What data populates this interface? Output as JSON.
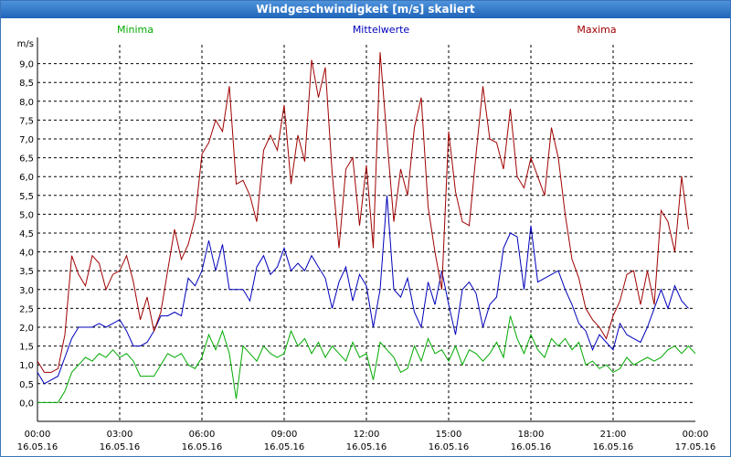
{
  "window": {
    "title": "Windgeschwindigkeit [m/s] skaliert"
  },
  "colors": {
    "minima": "#00aa00",
    "mittelwerte": "#0000bb",
    "maxima": "#a00000",
    "grid": "#000000",
    "titlebar": "#2a6fc2"
  },
  "chart_data": {
    "type": "line",
    "title": "Windgeschwindigkeit [m/s] skaliert",
    "ylabel": "m/s",
    "xlabel": "",
    "ylim": [
      -0.5,
      9.5
    ],
    "yticks": [
      "0,0",
      "0,5",
      "1,0",
      "1,5",
      "2,0",
      "2,5",
      "3,0",
      "3,5",
      "4,0",
      "4,5",
      "5,0",
      "5,5",
      "6,0",
      "6,5",
      "7,0",
      "7,5",
      "8,0",
      "8,5",
      "9,0"
    ],
    "xticks": [
      {
        "time": "00:00",
        "date": "16.05.16"
      },
      {
        "time": "03:00",
        "date": "16.05.16"
      },
      {
        "time": "06:00",
        "date": "16.05.16"
      },
      {
        "time": "09:00",
        "date": "16.05.16"
      },
      {
        "time": "12:00",
        "date": "16.05.16"
      },
      {
        "time": "15:00",
        "date": "16.05.16"
      },
      {
        "time": "18:00",
        "date": "16.05.16"
      },
      {
        "time": "21:00",
        "date": "16.05.16"
      },
      {
        "time": "00:00",
        "date": "17.05.16"
      }
    ],
    "x_unit": "hours",
    "grid": true,
    "legend": "top",
    "series": [
      {
        "name": "Minima",
        "color": "#00aa00",
        "points": [
          [
            0,
            0
          ],
          [
            0.25,
            0
          ],
          [
            0.5,
            0
          ],
          [
            0.75,
            0
          ],
          [
            1,
            0.3
          ],
          [
            1.25,
            0.8
          ],
          [
            1.5,
            1
          ],
          [
            1.75,
            1.2
          ],
          [
            2,
            1.1
          ],
          [
            2.25,
            1.3
          ],
          [
            2.5,
            1.2
          ],
          [
            2.75,
            1.4
          ],
          [
            3,
            1.2
          ],
          [
            3.25,
            1.3
          ],
          [
            3.5,
            1.1
          ],
          [
            3.75,
            0.7
          ],
          [
            4,
            0.7
          ],
          [
            4.25,
            0.7
          ],
          [
            4.5,
            1
          ],
          [
            4.75,
            1.3
          ],
          [
            5,
            1.2
          ],
          [
            5.25,
            1.3
          ],
          [
            5.5,
            1
          ],
          [
            5.75,
            0.9
          ],
          [
            6,
            1.2
          ],
          [
            6.25,
            1.8
          ],
          [
            6.5,
            1.4
          ],
          [
            6.75,
            1.9
          ],
          [
            7,
            1.3
          ],
          [
            7.25,
            0.1
          ],
          [
            7.5,
            1.5
          ],
          [
            7.75,
            1.3
          ],
          [
            8,
            1.1
          ],
          [
            8.25,
            1.5
          ],
          [
            8.5,
            1.3
          ],
          [
            8.75,
            1.2
          ],
          [
            9,
            1.3
          ],
          [
            9.25,
            1.9
          ],
          [
            9.5,
            1.5
          ],
          [
            9.75,
            1.7
          ],
          [
            10,
            1.3
          ],
          [
            10.25,
            1.6
          ],
          [
            10.5,
            1.2
          ],
          [
            10.75,
            1.5
          ],
          [
            11,
            1.3
          ],
          [
            11.25,
            1.1
          ],
          [
            11.5,
            1.6
          ],
          [
            11.75,
            1.2
          ],
          [
            12,
            1.3
          ],
          [
            12.25,
            0.6
          ],
          [
            12.5,
            1.6
          ],
          [
            12.75,
            1.4
          ],
          [
            13,
            1.2
          ],
          [
            13.25,
            0.8
          ],
          [
            13.5,
            0.9
          ],
          [
            13.75,
            1.5
          ],
          [
            14,
            1.1
          ],
          [
            14.25,
            1.7
          ],
          [
            14.5,
            1.3
          ],
          [
            14.75,
            1.4
          ],
          [
            15,
            1.1
          ],
          [
            15.25,
            1.5
          ],
          [
            15.5,
            1
          ],
          [
            15.75,
            1.4
          ],
          [
            16,
            1.3
          ],
          [
            16.25,
            1.1
          ],
          [
            16.5,
            1.3
          ],
          [
            16.75,
            1.6
          ],
          [
            17,
            1.2
          ],
          [
            17.25,
            2.3
          ],
          [
            17.5,
            1.7
          ],
          [
            17.75,
            1.3
          ],
          [
            18,
            1.8
          ],
          [
            18.25,
            1.4
          ],
          [
            18.5,
            1.2
          ],
          [
            18.75,
            1.7
          ],
          [
            19,
            1.5
          ],
          [
            19.25,
            1.7
          ],
          [
            19.5,
            1.4
          ],
          [
            19.75,
            1.6
          ],
          [
            20,
            1
          ],
          [
            20.25,
            1.1
          ],
          [
            20.5,
            0.9
          ],
          [
            20.75,
            1
          ],
          [
            21,
            0.8
          ],
          [
            21.25,
            0.9
          ],
          [
            21.5,
            1.2
          ],
          [
            21.75,
            1
          ],
          [
            22,
            1.1
          ],
          [
            22.25,
            1.2
          ],
          [
            22.5,
            1.1
          ],
          [
            22.75,
            1.2
          ],
          [
            23,
            1.4
          ],
          [
            23.25,
            1.5
          ],
          [
            23.5,
            1.3
          ],
          [
            23.75,
            1.5
          ],
          [
            24,
            1.3
          ]
        ]
      },
      {
        "name": "Mittelwerte",
        "color": "#0000bb",
        "points": [
          [
            0,
            0.8
          ],
          [
            0.25,
            0.5
          ],
          [
            0.5,
            0.6
          ],
          [
            0.75,
            0.7
          ],
          [
            1,
            1.2
          ],
          [
            1.25,
            1.7
          ],
          [
            1.5,
            2
          ],
          [
            1.75,
            2
          ],
          [
            2,
            2
          ],
          [
            2.25,
            2.1
          ],
          [
            2.5,
            2
          ],
          [
            2.75,
            2.1
          ],
          [
            3,
            2.2
          ],
          [
            3.25,
            1.9
          ],
          [
            3.5,
            1.5
          ],
          [
            3.75,
            1.5
          ],
          [
            4,
            1.6
          ],
          [
            4.25,
            1.9
          ],
          [
            4.5,
            2.3
          ],
          [
            4.75,
            2.3
          ],
          [
            5,
            2.4
          ],
          [
            5.25,
            2.3
          ],
          [
            5.5,
            3.3
          ],
          [
            5.75,
            3.1
          ],
          [
            6,
            3.5
          ],
          [
            6.25,
            4.3
          ],
          [
            6.5,
            3.5
          ],
          [
            6.75,
            4.2
          ],
          [
            7,
            3
          ],
          [
            7.25,
            3
          ],
          [
            7.5,
            3
          ],
          [
            7.75,
            2.7
          ],
          [
            8,
            3.6
          ],
          [
            8.25,
            3.9
          ],
          [
            8.5,
            3.4
          ],
          [
            8.75,
            3.6
          ],
          [
            9,
            4.1
          ],
          [
            9.25,
            3.5
          ],
          [
            9.5,
            3.7
          ],
          [
            9.75,
            3.5
          ],
          [
            10,
            3.9
          ],
          [
            10.25,
            3.6
          ],
          [
            10.5,
            3.3
          ],
          [
            10.75,
            2.5
          ],
          [
            11,
            3.2
          ],
          [
            11.25,
            3.6
          ],
          [
            11.5,
            2.7
          ],
          [
            11.75,
            3.4
          ],
          [
            12,
            3.1
          ],
          [
            12.25,
            2
          ],
          [
            12.5,
            3
          ],
          [
            12.75,
            5.5
          ],
          [
            13,
            3
          ],
          [
            13.25,
            2.8
          ],
          [
            13.5,
            3.3
          ],
          [
            13.75,
            2.4
          ],
          [
            14,
            2
          ],
          [
            14.25,
            3.2
          ],
          [
            14.5,
            2.6
          ],
          [
            14.75,
            3.5
          ],
          [
            15,
            2.6
          ],
          [
            15.25,
            1.8
          ],
          [
            15.5,
            3
          ],
          [
            15.75,
            3.2
          ],
          [
            16,
            2.9
          ],
          [
            16.25,
            2
          ],
          [
            16.5,
            2.6
          ],
          [
            16.75,
            2.8
          ],
          [
            17,
            4.1
          ],
          [
            17.25,
            4.5
          ],
          [
            17.5,
            4.4
          ],
          [
            17.75,
            3
          ],
          [
            18,
            4.7
          ],
          [
            18.25,
            3.2
          ],
          [
            18.5,
            3.3
          ],
          [
            18.75,
            3.4
          ],
          [
            19,
            3.5
          ],
          [
            19.25,
            3
          ],
          [
            19.5,
            2.6
          ],
          [
            19.75,
            2.1
          ],
          [
            20,
            1.9
          ],
          [
            20.25,
            1.4
          ],
          [
            20.5,
            1.8
          ],
          [
            20.75,
            1.6
          ],
          [
            21,
            1.4
          ],
          [
            21.25,
            2.1
          ],
          [
            21.5,
            1.8
          ],
          [
            21.75,
            1.7
          ],
          [
            22,
            1.6
          ],
          [
            22.25,
            2
          ],
          [
            22.5,
            2.5
          ],
          [
            22.75,
            3
          ],
          [
            23,
            2.5
          ],
          [
            23.25,
            3.1
          ],
          [
            23.5,
            2.7
          ],
          [
            23.75,
            2.5
          ]
        ]
      },
      {
        "name": "Maxima",
        "color": "#a00000",
        "points": [
          [
            0,
            1.1
          ],
          [
            0.25,
            0.8
          ],
          [
            0.5,
            0.8
          ],
          [
            0.75,
            0.9
          ],
          [
            1,
            1.8
          ],
          [
            1.25,
            3.9
          ],
          [
            1.5,
            3.4
          ],
          [
            1.75,
            3.1
          ],
          [
            2,
            3.9
          ],
          [
            2.25,
            3.7
          ],
          [
            2.5,
            3
          ],
          [
            2.75,
            3.4
          ],
          [
            3,
            3.5
          ],
          [
            3.25,
            3.9
          ],
          [
            3.5,
            3.2
          ],
          [
            3.75,
            2.2
          ],
          [
            4,
            2.8
          ],
          [
            4.25,
            1.9
          ],
          [
            4.5,
            2.4
          ],
          [
            4.75,
            3.5
          ],
          [
            5,
            4.6
          ],
          [
            5.25,
            3.8
          ],
          [
            5.5,
            4.2
          ],
          [
            5.75,
            4.9
          ],
          [
            6,
            6.6
          ],
          [
            6.25,
            6.9
          ],
          [
            6.5,
            7.5
          ],
          [
            6.75,
            7.2
          ],
          [
            7,
            8.4
          ],
          [
            7.25,
            5.8
          ],
          [
            7.5,
            5.9
          ],
          [
            7.75,
            5.5
          ],
          [
            8,
            4.8
          ],
          [
            8.25,
            6.7
          ],
          [
            8.5,
            7.1
          ],
          [
            8.75,
            6.7
          ],
          [
            9,
            7.9
          ],
          [
            9.25,
            5.8
          ],
          [
            9.5,
            7.1
          ],
          [
            9.75,
            6.4
          ],
          [
            10,
            9.1
          ],
          [
            10.25,
            8.1
          ],
          [
            10.5,
            8.9
          ],
          [
            10.75,
            6.1
          ],
          [
            11,
            4.1
          ],
          [
            11.25,
            6.2
          ],
          [
            11.5,
            6.5
          ],
          [
            11.75,
            4.7
          ],
          [
            12,
            6.3
          ],
          [
            12.25,
            4.1
          ],
          [
            12.5,
            9.3
          ],
          [
            12.75,
            7
          ],
          [
            13,
            4.8
          ],
          [
            13.25,
            6.2
          ],
          [
            13.5,
            5.5
          ],
          [
            13.75,
            7.3
          ],
          [
            14,
            8.1
          ],
          [
            14.25,
            5.2
          ],
          [
            14.5,
            4
          ],
          [
            14.75,
            3
          ],
          [
            15,
            7.2
          ],
          [
            15.25,
            5.6
          ],
          [
            15.5,
            4.8
          ],
          [
            15.75,
            4.7
          ],
          [
            16,
            6.6
          ],
          [
            16.25,
            8.4
          ],
          [
            16.5,
            7
          ],
          [
            16.75,
            6.9
          ],
          [
            17,
            6.2
          ],
          [
            17.25,
            7.8
          ],
          [
            17.5,
            6
          ],
          [
            17.75,
            5.7
          ],
          [
            18,
            6.5
          ],
          [
            18.25,
            6
          ],
          [
            18.5,
            5.5
          ],
          [
            18.75,
            7.3
          ],
          [
            19,
            6.5
          ],
          [
            19.25,
            5
          ],
          [
            19.5,
            3.8
          ],
          [
            19.75,
            3.3
          ],
          [
            20,
            2.5
          ],
          [
            20.25,
            2.2
          ],
          [
            20.5,
            2
          ],
          [
            20.75,
            1.7
          ],
          [
            21,
            2.3
          ],
          [
            21.25,
            2.7
          ],
          [
            21.5,
            3.4
          ],
          [
            21.75,
            3.5
          ],
          [
            22,
            2.6
          ],
          [
            22.25,
            3.5
          ],
          [
            22.5,
            2.6
          ],
          [
            22.75,
            5.1
          ],
          [
            23,
            4.8
          ],
          [
            23.25,
            4
          ],
          [
            23.5,
            6
          ],
          [
            23.75,
            4.6
          ]
        ]
      }
    ]
  }
}
